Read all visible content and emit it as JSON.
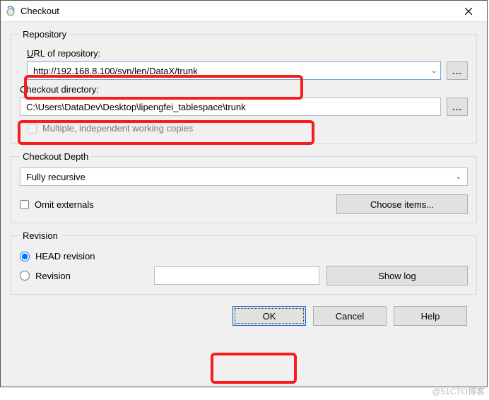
{
  "window": {
    "title": "Checkout",
    "close_tooltip": "Close"
  },
  "repository": {
    "legend": "Repository",
    "url_label_prefix": "U",
    "url_label_rest": "RL of repository:",
    "url_value": "http://192.168.8.100/svn/len/DataX/trunk",
    "browse_url_label": "...",
    "dir_label": "Checkout directory:",
    "dir_value": "C:\\Users\\DataDev\\Desktop\\lipengfei_tablespace\\trunk",
    "browse_dir_label": "...",
    "multiple_label": "Multiple, independent working copies"
  },
  "depth": {
    "legend": "Checkout Depth",
    "selected": "Fully recursive",
    "omit_externals_label": "Omit externals",
    "choose_items_label": "Choose items..."
  },
  "revision": {
    "legend": "Revision",
    "head_label": "HEAD revision",
    "revision_label": "Revision",
    "revision_value": "",
    "show_log_label": "Show log"
  },
  "footer": {
    "ok": "OK",
    "cancel": "Cancel",
    "help": "Help"
  },
  "watermark": "@51CTO博客"
}
